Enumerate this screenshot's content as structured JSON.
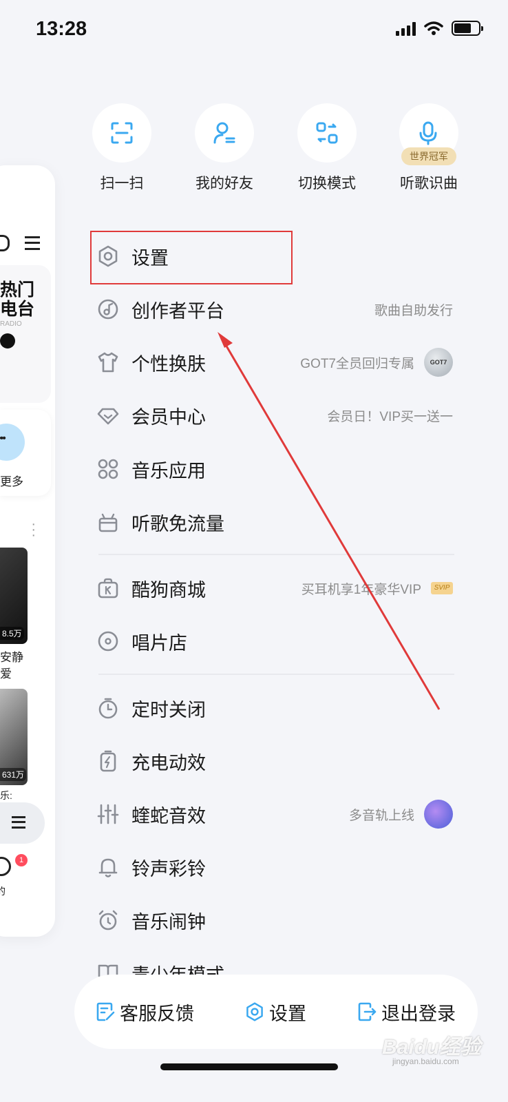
{
  "status": {
    "time": "13:28",
    "battery_level": 0.7
  },
  "peek": {
    "radio_line1": "热门",
    "radio_line2": "电台",
    "radio_en": "RADIO",
    "more_label": "更多",
    "count1": "8.5万",
    "text1a": "安静",
    "text1b": "爱",
    "count2": "631万",
    "text2": "乐:",
    "badge": "1",
    "me_label": "我的"
  },
  "shortcuts": [
    {
      "label": "扫一扫",
      "icon": "scan-icon"
    },
    {
      "label": "我的好友",
      "icon": "friends-icon"
    },
    {
      "label": "切换模式",
      "icon": "switch-mode-icon"
    },
    {
      "label": "听歌识曲",
      "icon": "song-recognition-icon",
      "badge": "世界冠军"
    }
  ],
  "menu": {
    "settings": "设置",
    "creator": {
      "label": "创作者平台",
      "sub": "歌曲自助发行"
    },
    "skin": {
      "label": "个性换肤",
      "sub": "GOT7全员回归专属",
      "avatar_text": "GOT7"
    },
    "vip": {
      "label": "会员中心",
      "sub": "会员日！VIP买一送一"
    },
    "apps": "音乐应用",
    "free_data": "听歌免流量",
    "mall": {
      "label": "酷狗商城",
      "sub": "买耳机享1年豪华VIP",
      "tag": "SVIP"
    },
    "record_store": "唱片店",
    "timer": "定时关闭",
    "charging": "充电动效",
    "viper": {
      "label": "蝰蛇音效",
      "sub": "多音轨上线"
    },
    "ringtone": "铃声彩铃",
    "alarm": "音乐闹钟",
    "teen": "青少年模式"
  },
  "bottom": {
    "feedback": "客服反馈",
    "settings": "设置",
    "logout": "退出登录"
  },
  "watermark": {
    "brand": "Baidu经验",
    "sub": "jingyan.baidu.com"
  },
  "colors": {
    "accent": "#3aa8f0",
    "annotation": "#e03a3a"
  }
}
